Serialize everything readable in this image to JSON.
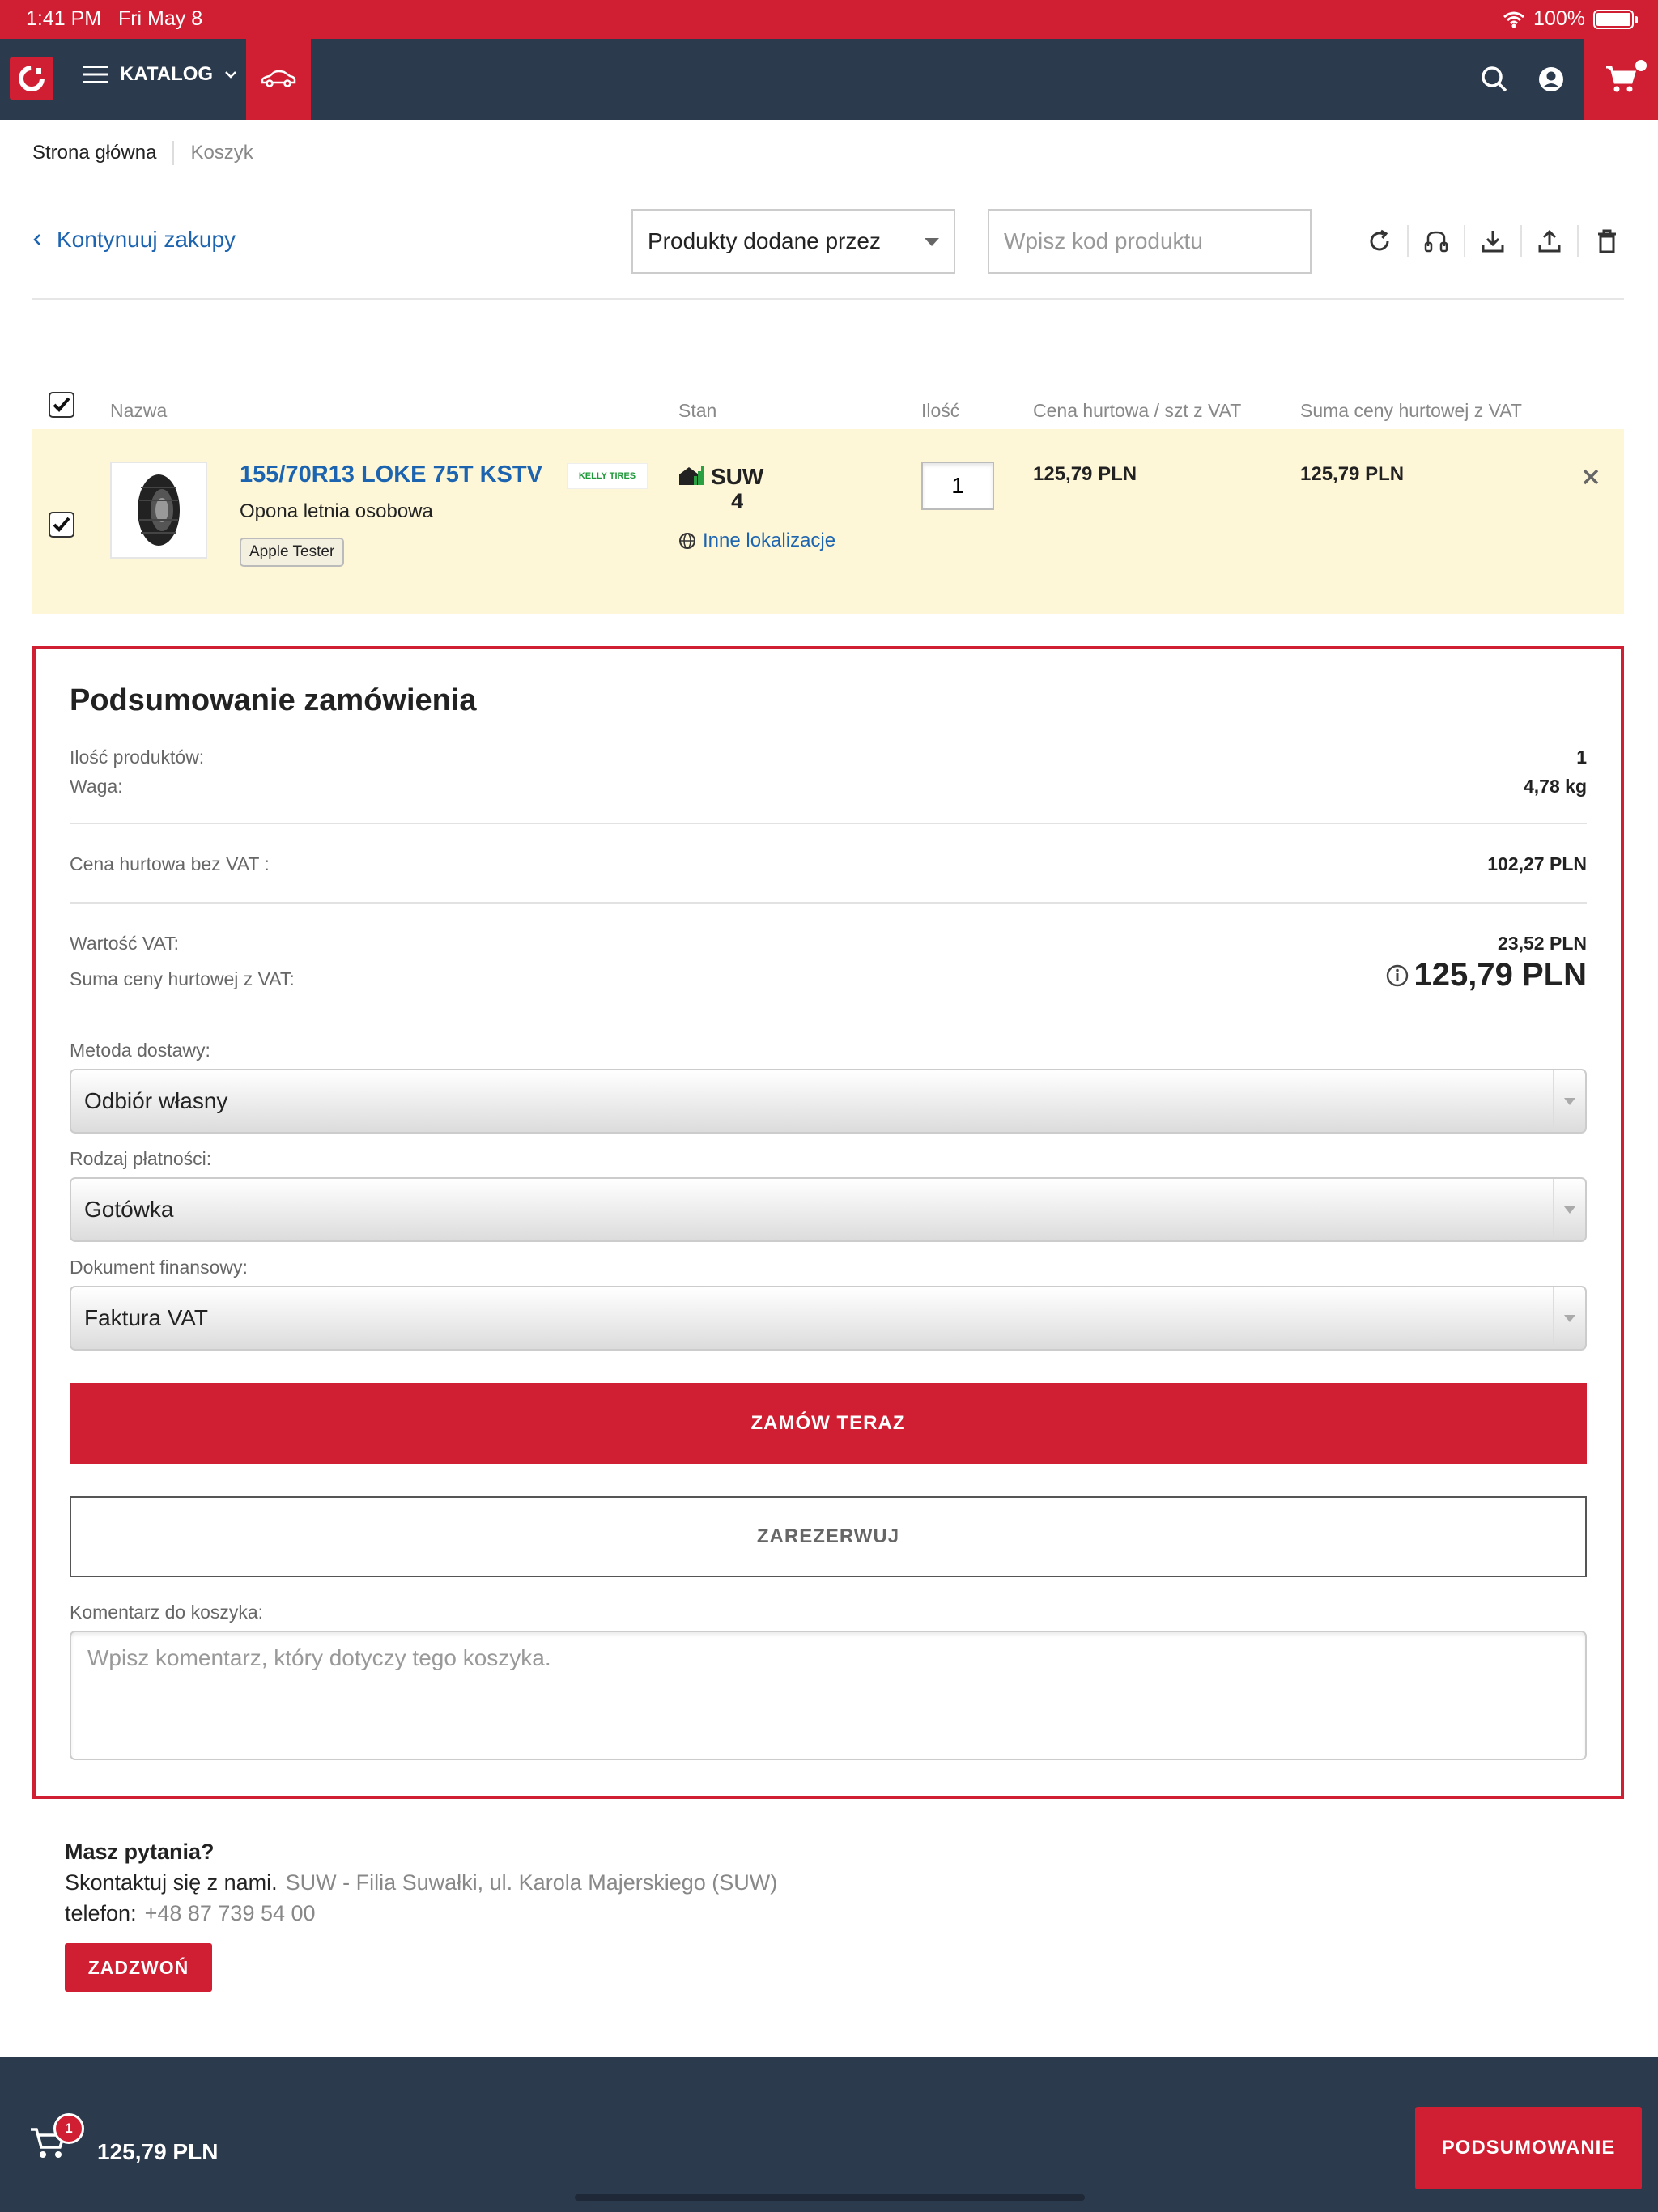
{
  "status_bar": {
    "time": "1:41 PM",
    "date": "Fri May 8",
    "battery": "100%"
  },
  "navbar": {
    "catalog_label": "KATALOG"
  },
  "breadcrumb": {
    "home": "Strona główna",
    "current": "Koszyk"
  },
  "toolbar": {
    "continue_label": "Kontynuuj zakupy",
    "filter_value": "Produkty dodane przez",
    "code_placeholder": "Wpisz kod produktu"
  },
  "table": {
    "headers": {
      "name": "Nazwa",
      "stock": "Stan",
      "qty": "Ilość",
      "unit_price": "Cena hurtowa / szt z VAT",
      "total_price": "Suma ceny hurtowej z VAT"
    },
    "row": {
      "name": "155/70R13 LOKE 75T KSTV",
      "description": "Opona letnia osobowa",
      "tag": "Apple Tester",
      "brand": "KELLY TIRES",
      "warehouse": "SUW",
      "warehouse_qty": "4",
      "other_locations": "Inne lokalizacje",
      "quantity": "1",
      "unit_price": "125,79 PLN",
      "total_price": "125,79 PLN"
    }
  },
  "summary": {
    "title": "Podsumowanie zamówienia",
    "product_count_label": "Ilość produktów:",
    "product_count": "1",
    "weight_label": "Waga:",
    "weight": "4,78 kg",
    "net_label": "Cena hurtowa bez VAT :",
    "net_value": "102,27 PLN",
    "vat_label": "Wartość VAT:",
    "vat_value": "23,52 PLN",
    "gross_label": "Suma ceny hurtowej z VAT:",
    "gross_value": "125,79 PLN",
    "delivery_label": "Metoda dostawy:",
    "delivery_value": "Odbiór własny",
    "payment_label": "Rodzaj płatności:",
    "payment_value": "Gotówka",
    "document_label": "Dokument finansowy:",
    "document_value": "Faktura VAT",
    "order_button": "ZAMÓW TERAZ",
    "reserve_button": "ZAREZERWUJ",
    "comment_label": "Komentarz do koszyka:",
    "comment_placeholder": "Wpisz komentarz, który dotyczy tego koszyka."
  },
  "contact": {
    "title": "Masz pytania?",
    "contact_label": "Skontaktuj się z nami.",
    "branch": "SUW - Filia Suwałki, ul. Karola Majerskiego (SUW)",
    "phone_label": "telefon:",
    "phone": "+48 87 739 54 00",
    "call_button": "ZADZWOŃ"
  },
  "footer": {
    "cart_count": "1",
    "total": "125,79 PLN",
    "summary_button": "PODSUMOWANIE"
  },
  "colors": {
    "brand_red": "#d01e32",
    "navy": "#2b3a4d",
    "link_blue": "#1d64b0",
    "row_highlight": "#fdf7d8"
  }
}
